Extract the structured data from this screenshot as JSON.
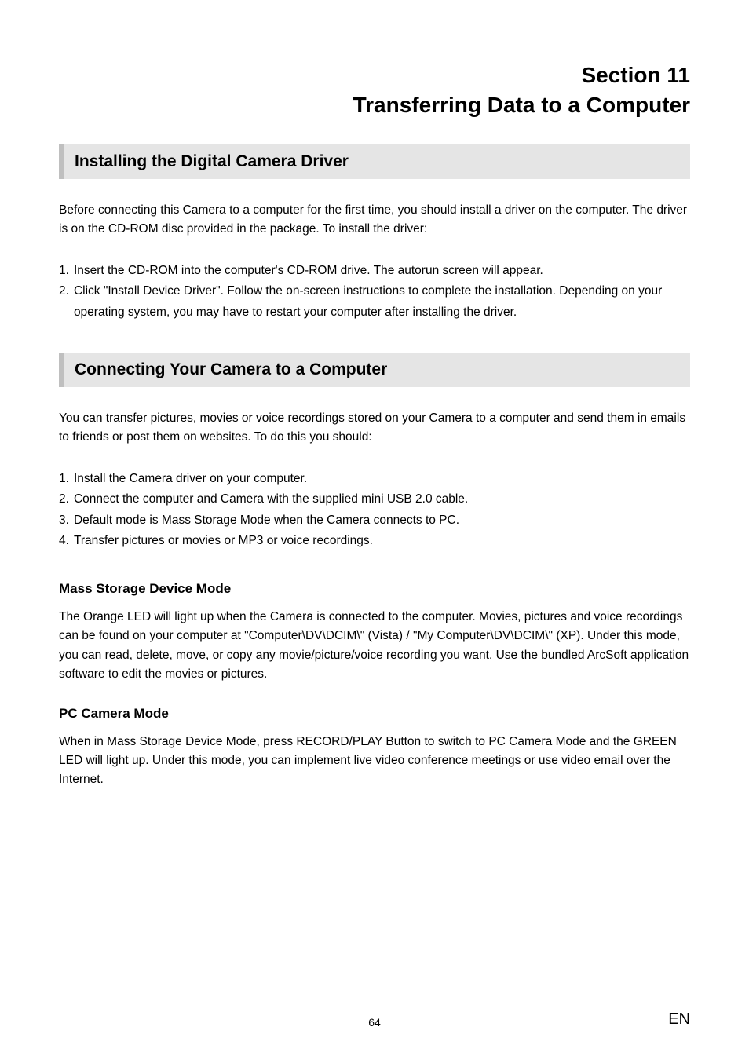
{
  "header": {
    "section_label": "Section 11",
    "section_title": "Transferring Data to a Computer"
  },
  "block1": {
    "heading": "Installing the Digital Camera Driver",
    "intro": "Before connecting this Camera to a computer for the first time, you should install a driver on the computer. The driver is on the CD-ROM disc provided in the package. To install the driver:",
    "items": [
      {
        "n": "1.",
        "t": "Insert the CD-ROM into the computer's CD-ROM drive. The autorun screen will appear."
      },
      {
        "n": "2.",
        "t": "Click \"Install Device Driver\". Follow the on-screen instructions to complete the installation. Depending on your operating system, you may have to restart your computer after installing the driver."
      }
    ]
  },
  "block2": {
    "heading": "Connecting Your Camera to a Computer",
    "intro": "You can transfer pictures, movies or voice recordings stored on your Camera to a computer and send them in emails to friends or post them on websites. To do this you should:",
    "items": [
      {
        "n": "1.",
        "t": "Install the Camera driver on your computer."
      },
      {
        "n": "2.",
        "t": "Connect the computer and Camera with the supplied mini USB 2.0 cable."
      },
      {
        "n": "3.",
        "t": "Default mode is Mass Storage Mode when the Camera connects to PC."
      },
      {
        "n": "4.",
        "t": "Transfer pictures or movies or MP3 or voice recordings."
      }
    ]
  },
  "block3": {
    "heading": "Mass Storage Device Mode",
    "body": "The Orange LED will light up when the Camera is connected to the computer. Movies, pictures and voice recordings can be found on your computer at \"Computer\\DV\\DCIM\\\" (Vista) / \"My Computer\\DV\\DCIM\\\" (XP). Under this mode, you can read, delete, move, or copy any movie/picture/voice recording you want. Use the bundled ArcSoft application software to edit the movies or pictures."
  },
  "block4": {
    "heading": "PC Camera Mode",
    "body": "When in Mass Storage Device Mode, press RECORD/PLAY Button to switch to PC Camera Mode and the GREEN LED will light up. Under this mode, you can implement live video conference meetings or use video email over the Internet."
  },
  "footer": {
    "page": "64",
    "lang": "EN"
  }
}
